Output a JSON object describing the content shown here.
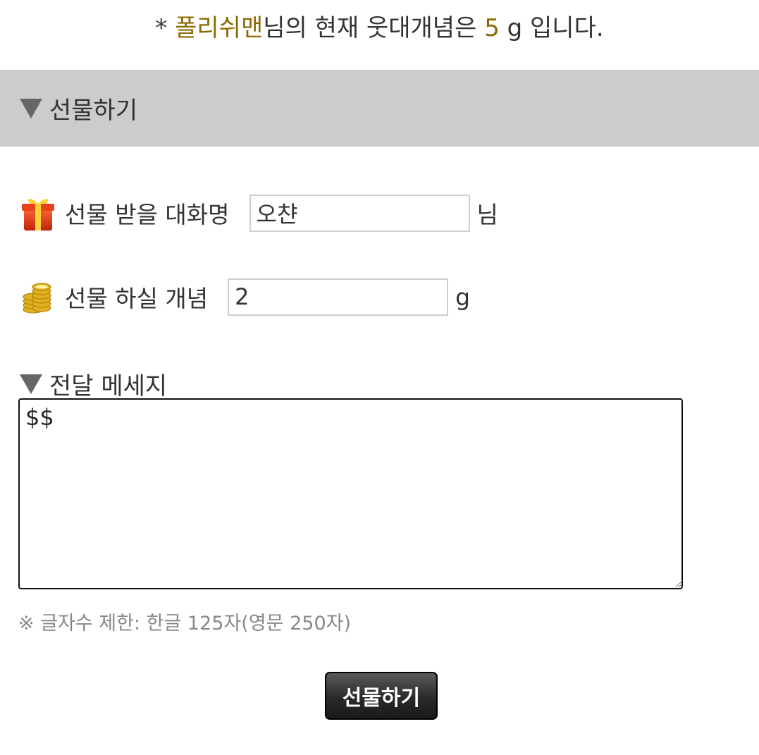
{
  "balance": {
    "prefix": "* ",
    "username": "폴리쉬맨",
    "middle": "님의 현재 웃대개념은 ",
    "amount": "5",
    "suffix": " g 입니다."
  },
  "section": {
    "title": "선물하기"
  },
  "recipient": {
    "label": "선물 받을 대화명",
    "value": "오챤",
    "unit": "님",
    "icon": "gift-box-icon"
  },
  "amount": {
    "label": "선물 하실 개념",
    "value": "2",
    "unit": "g",
    "icon": "gold-coins-icon"
  },
  "message": {
    "title": "전달 메세지",
    "value": "$$"
  },
  "limit_note": "※ 글자수 제한: 한글 125자(영문 250자)",
  "submit_label": "선물하기",
  "colors": {
    "accent": "#8a6a00",
    "section_bar": "#cccccc",
    "button": "#2a2a2a"
  }
}
